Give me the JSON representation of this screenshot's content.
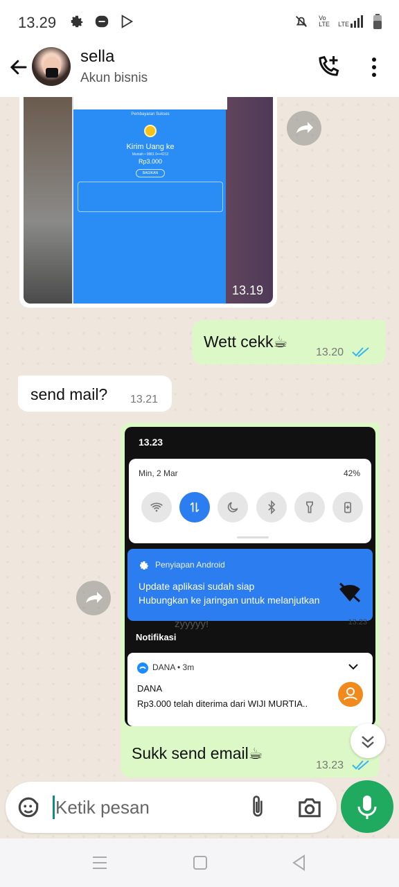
{
  "status_bar": {
    "time": "13.29",
    "icons_left": [
      "gear-icon",
      "chat-icon",
      "play-icon"
    ],
    "icons_right": [
      "mute-icon",
      "volte-icon",
      "lte-signal-icon",
      "battery-icon"
    ],
    "volte_label": "Vo LTE",
    "lte_label": "LTE"
  },
  "header": {
    "contact_name": "sella",
    "contact_subtitle": "Akun bisnis"
  },
  "messages": {
    "image1": {
      "time": "13.19",
      "screenshot": {
        "title": "Pembayaran Sukses",
        "heading": "Kirim Uang ke",
        "recipient": "Muniah • 0881 0•••4212",
        "amount": "Rp3.000",
        "button": "BAGIKAN"
      }
    },
    "out1": {
      "text": "Wett cekk☕",
      "time": "13.20"
    },
    "in1": {
      "text": "send mail?",
      "time": "13.21"
    },
    "image2": {
      "screenshot": {
        "time": "13.23",
        "date": "Min, 2 Mar",
        "battery": "42%",
        "notif1_app": "Penyiapan Android",
        "notif1_title": "Update aplikasi sudah siap",
        "notif1_body": "Hubungkan ke jaringan untuk melanjutkan",
        "ghost_text": "zyyyyy!",
        "ghost_time": "13.23",
        "section_label": "Notifikasi",
        "notif2_app": "DANA • 3m",
        "notif2_title": "DANA",
        "notif2_body": "Rp3.000 telah diterima dari WIJI MURTIA.."
      },
      "caption": "Sukk send email☕",
      "time": "13.23"
    }
  },
  "composer": {
    "placeholder": "Ketik pesan"
  },
  "colors": {
    "outgoing_bubble": "#dcf8c6",
    "incoming_bubble": "#ffffff",
    "chat_bg": "#efe7dd",
    "mic_button": "#1faa5f",
    "read_ticks": "#34b7f1",
    "quick_tile_on": "#2c7df0"
  }
}
